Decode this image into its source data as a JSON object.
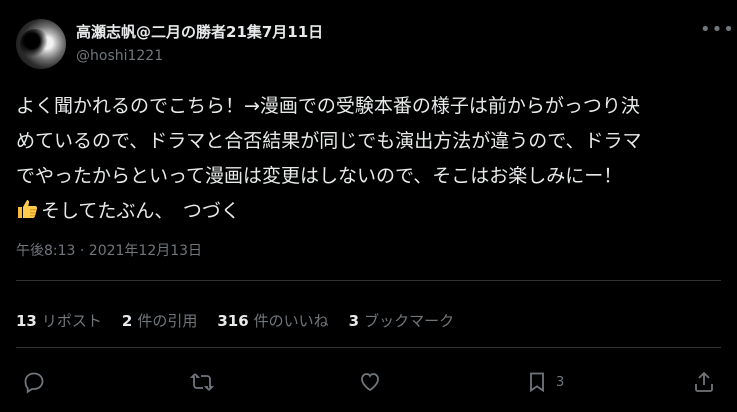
{
  "author": {
    "name": "高瀬志帆@二月の勝者21集7月11日",
    "handle": "@hoshi1221"
  },
  "tweet": {
    "lines": [
      "よく聞かれるのでこちら！→漫画での受験本番の様子は前からがっつり決",
      "めているので、ドラマと合否結果が同じでも演出方法が違うので、ドラマ",
      "でやったからといって漫画は変更はしないので、そこはお楽しみにー！",
      "そしてたぶん、　つづく"
    ],
    "emoji": "thumbs-up"
  },
  "meta": {
    "timestamp": "午後8:13 · 2021年12月13日"
  },
  "stats": {
    "retweets_count": "13",
    "retweets_label": "リポスト",
    "quotes_count": "2",
    "quotes_label": "件の引用",
    "likes_count": "316",
    "likes_label": "件のいいね",
    "bookmarks_count": "3",
    "bookmarks_label": "ブックマーク"
  },
  "actions": {
    "bookmark_count": "3"
  },
  "colors": {
    "background": "#000000",
    "text": "#e7e9ea",
    "muted": "#71767b",
    "divider": "#2f3336",
    "emoji": "#f6b93b"
  }
}
